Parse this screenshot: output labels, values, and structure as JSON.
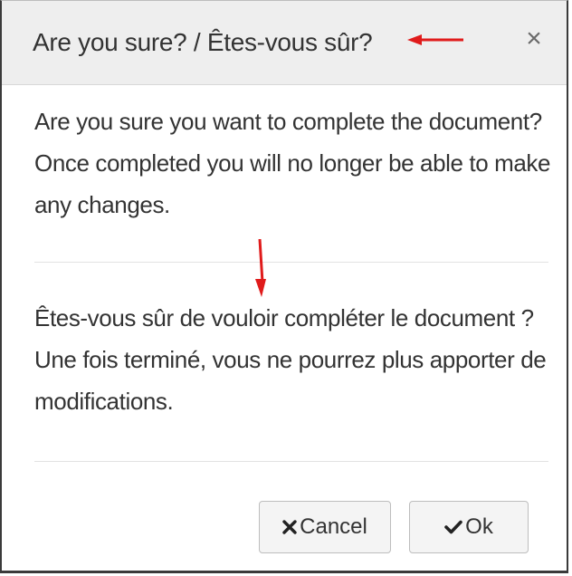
{
  "dialog": {
    "title": "Are you sure? / Êtes-vous sûr?",
    "close_glyph": "×",
    "message_en": "Are you sure you want to complete the document? Once completed you will no longer be able to make any changes.",
    "message_fr": "Êtes-vous sûr de vouloir compléter le document ? Une fois terminé, vous ne pourrez plus apporter de modifications.",
    "cancel_label": "Cancel",
    "ok_label": "Ok"
  },
  "icons": {
    "close": "close-icon",
    "cancel": "x-icon",
    "ok": "check-icon",
    "annotation_arrows": "red-arrow-icon"
  },
  "colors": {
    "header_bg": "#eeeeee",
    "text": "#333333",
    "annotation_red": "#e01b1b"
  }
}
